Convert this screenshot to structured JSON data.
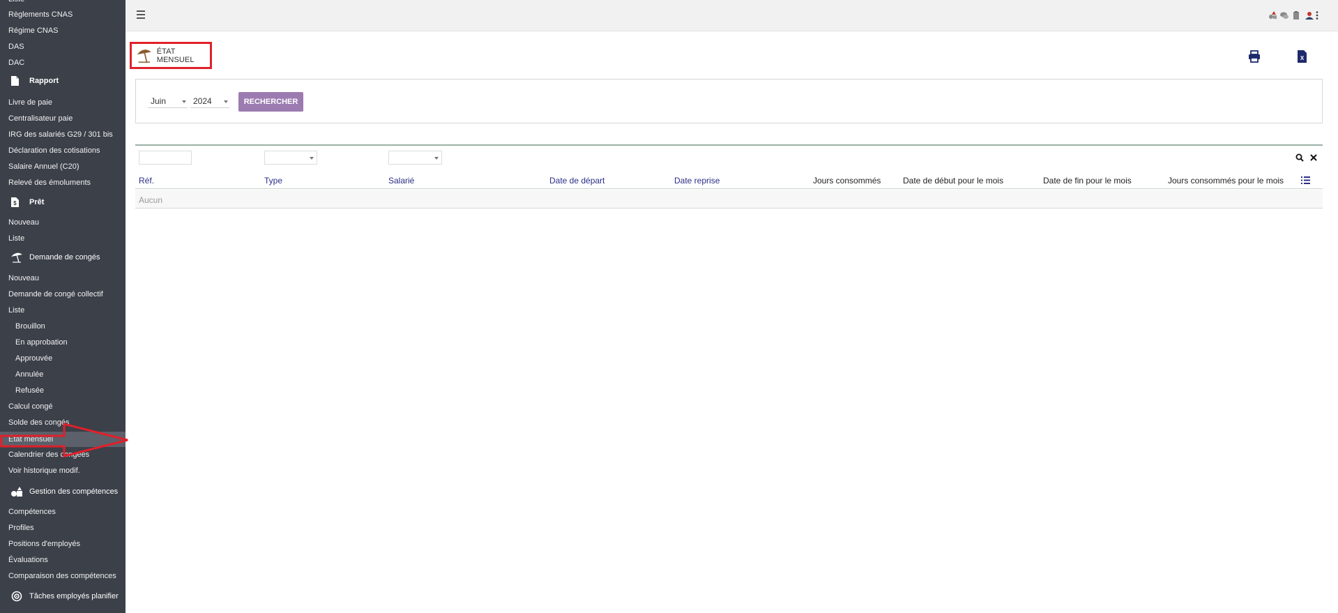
{
  "sidebar": {
    "items_top": [
      "Règlements CNAS",
      "Régime CNAS",
      "DAS",
      "DAC"
    ],
    "rapport_label": "Rapport",
    "rapport_items": [
      "Livre de paie",
      "Centralisateur paie",
      "IRG des salariés G29 / 301 bis",
      "Déclaration des cotisations",
      "Salaire Annuel (C20)",
      "Relevé des émoluments"
    ],
    "pret_label": "Prêt",
    "pret_items": [
      "Nouveau",
      "Liste"
    ],
    "conges_label": "Demande de congés",
    "conges_items": [
      "Nouveau",
      "Demande de congé collectif",
      "Liste"
    ],
    "conges_sub": [
      "Brouillon",
      "En approbation",
      "Approuvée",
      "Annulée",
      "Refusée"
    ],
    "conges_more": [
      "Calcul congé",
      "Solde des congés",
      "État mensuel",
      "Calendrier des congées",
      "Voir historique modif."
    ],
    "competences_label": "Gestion des compétences",
    "competences_items": [
      "Compétences",
      "Profiles",
      "Positions d'employés",
      "Évaluations",
      "Comparaison des compétences"
    ],
    "taches_label": "Tâches employés planifier"
  },
  "page": {
    "title": "ÉTAT MENSUEL"
  },
  "filters": {
    "month": "Juin",
    "year": "2024",
    "search_label": "RECHERCHER"
  },
  "table": {
    "columns": [
      "Réf.",
      "Type",
      "Salarié",
      "Date de départ",
      "Date reprise",
      "Jours consommés",
      "Date de début pour le mois",
      "Date de fin pour le mois",
      "Jours consommés pour le mois"
    ],
    "empty_text": "Aucun"
  },
  "colors": {
    "sidebar_bg": "#3b4049",
    "accent_button": "#9b7bb0",
    "header_link": "#2a2e86",
    "annotation_red": "#e0202a"
  }
}
